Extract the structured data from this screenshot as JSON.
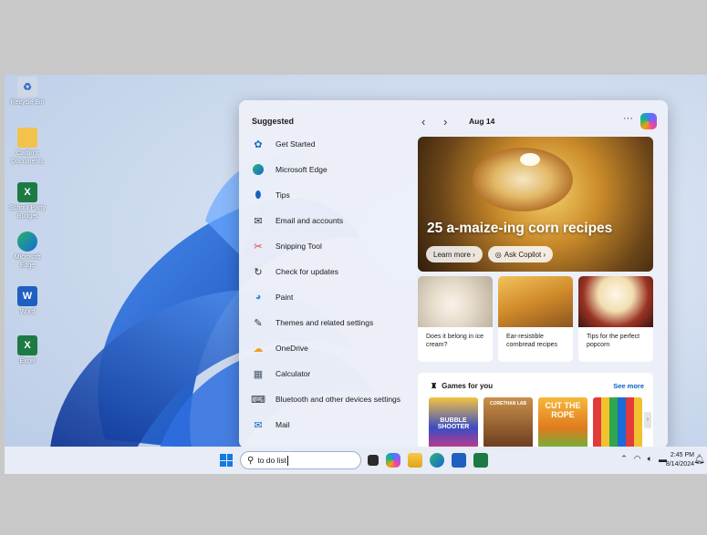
{
  "desktop": {
    "icons": [
      {
        "label": "Recycle Bin",
        "icon": "recycle-bin-icon"
      },
      {
        "label": "Caitlin's Documents",
        "icon": "folder-icon"
      },
      {
        "label": "School Party Budget",
        "icon": "excel-file-icon"
      },
      {
        "label": "Microsoft Edge",
        "icon": "edge-icon"
      },
      {
        "label": "Word",
        "icon": "word-icon"
      },
      {
        "label": "Excel",
        "icon": "excel-icon"
      }
    ]
  },
  "widgets": {
    "suggested_title": "Suggested",
    "suggested": [
      {
        "label": "Get Started",
        "icon": "get-started-icon"
      },
      {
        "label": "Microsoft Edge",
        "icon": "edge-icon"
      },
      {
        "label": "Tips",
        "icon": "tips-icon"
      },
      {
        "label": "Email and accounts",
        "icon": "mail-outline-icon"
      },
      {
        "label": "Snipping Tool",
        "icon": "snipping-tool-icon"
      },
      {
        "label": "Check for updates",
        "icon": "refresh-icon"
      },
      {
        "label": "Paint",
        "icon": "paint-icon"
      },
      {
        "label": "Themes and related settings",
        "icon": "brush-icon"
      },
      {
        "label": "OneDrive",
        "icon": "onedrive-icon"
      },
      {
        "label": "Calculator",
        "icon": "calculator-icon"
      },
      {
        "label": "Bluetooth and other devices settings",
        "icon": "devices-icon"
      },
      {
        "label": "Mail",
        "icon": "mail-icon"
      }
    ],
    "feed": {
      "prev": "‹",
      "next": "›",
      "date": "Aug 14",
      "more": "···",
      "hero": {
        "title": "25 a-maize-ing corn recipes",
        "learn_more": "Learn more ›",
        "ask_copilot": "Ask Copilot ›"
      },
      "cards": [
        {
          "text": "Does it belong in ice cream?",
          "color": "#cfc6b8"
        },
        {
          "text": "Ear-resistible cornbread recipes",
          "color": "#d6983a"
        },
        {
          "text": "Tips for the perfect popcorn",
          "color": "#8a2f22"
        }
      ],
      "games": {
        "title": "Games for you",
        "see_more": "See more",
        "tiles": [
          {
            "label": "BUBBLE SHOOTER",
            "color": "#3a4cc4"
          },
          {
            "label": "CORETHAN LAB",
            "color": "#6b3a1f"
          },
          {
            "label": "CUT THE ROPE",
            "color": "#e79a24"
          },
          {
            "label": "",
            "color": "#1b6bd8"
          }
        ]
      }
    }
  },
  "taskbar": {
    "search_value": "to do list",
    "time": "2:45 PM",
    "date": "8/14/2024"
  }
}
